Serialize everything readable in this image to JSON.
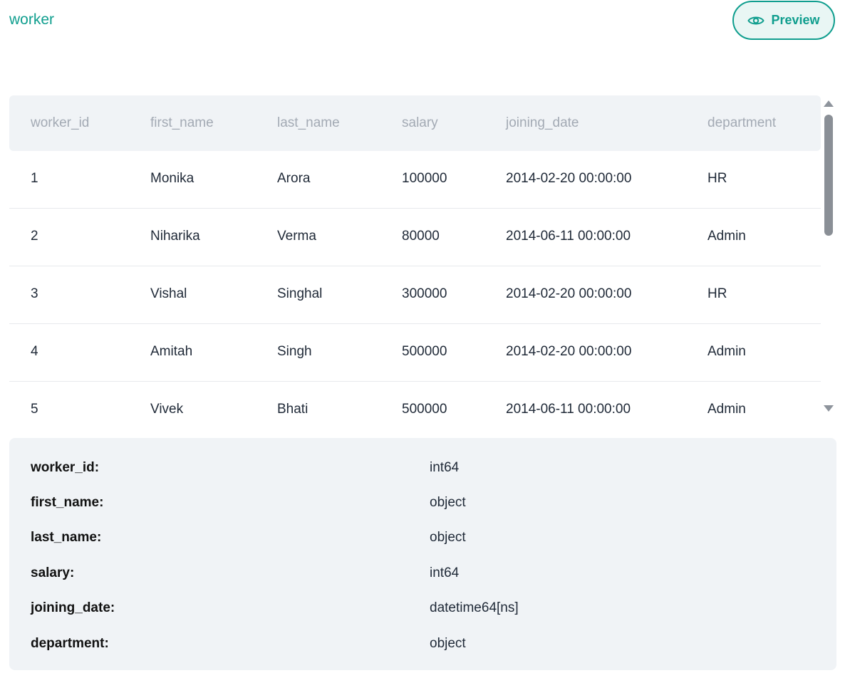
{
  "header": {
    "title": "worker",
    "preview_label": "Preview",
    "preview_icon": "eye-icon",
    "accent_color": "#0f9e8e"
  },
  "table": {
    "columns": [
      "worker_id",
      "first_name",
      "last_name",
      "salary",
      "joining_date",
      "department"
    ],
    "rows": [
      [
        "1",
        "Monika",
        "Arora",
        "100000",
        "2014-02-20 00:00:00",
        "HR"
      ],
      [
        "2",
        "Niharika",
        "Verma",
        "80000",
        "2014-06-11 00:00:00",
        "Admin"
      ],
      [
        "3",
        "Vishal",
        "Singhal",
        "300000",
        "2014-02-20 00:00:00",
        "HR"
      ],
      [
        "4",
        "Amitah",
        "Singh",
        "500000",
        "2014-02-20 00:00:00",
        "Admin"
      ],
      [
        "5",
        "Vivek",
        "Bhati",
        "500000",
        "2014-06-11 00:00:00",
        "Admin"
      ]
    ]
  },
  "schema": {
    "fields": [
      {
        "key": "worker_id:",
        "type": "int64"
      },
      {
        "key": "first_name:",
        "type": "object"
      },
      {
        "key": "last_name:",
        "type": "object"
      },
      {
        "key": "salary:",
        "type": "int64"
      },
      {
        "key": "joining_date:",
        "type": "datetime64[ns]"
      },
      {
        "key": "department:",
        "type": "object"
      }
    ]
  }
}
